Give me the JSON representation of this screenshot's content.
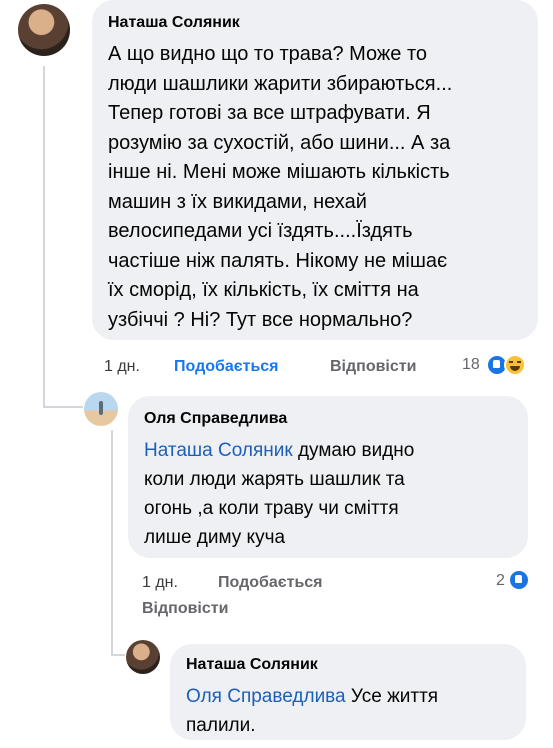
{
  "comments": [
    {
      "author": "Наташа Соляник",
      "lines": [
        "А що видно що то трава? Може то",
        "люди шашлики жарити збираються...",
        "Тепер готові за все штрафувати. Я",
        "розумію за сухостій,  або шини... А за",
        "інше ні. Мені може мішають кількість",
        "машин з їх викидами,  нехай",
        "велосипедами усі їздять....Їздять",
        "частіше ніж палять. Нікому не мішає",
        "їх сморід, їх кількість, їх сміття на",
        "узбіччі ? Ні? Тут все нормально?"
      ],
      "time": "1 дн.",
      "like_label": "Подобається",
      "reply_label": "Відповісти",
      "reaction_count": "18",
      "reactions": [
        "like-icon",
        "haha-icon"
      ]
    },
    {
      "author": "Оля Справедлива",
      "mention": "Наташа Соляник",
      "lines": [
        " думаю видно",
        "коли люди жарять шашлик та",
        "огонь ,а коли траву чи сміття",
        "лише диму куча"
      ],
      "time": "1 дн.",
      "like_label": "Подобається",
      "reply_label": "Відповісти",
      "reaction_count": "2",
      "reactions": [
        "like-icon"
      ]
    },
    {
      "author": "Наташа Соляник",
      "mention": "Оля Справедлива",
      "lines": [
        " Усе життя",
        "палили."
      ]
    }
  ],
  "colors": {
    "bubble": "#eef0f3",
    "mention": "#1d5fb8",
    "like_active": "#1877f2",
    "meta": "#65676b"
  }
}
